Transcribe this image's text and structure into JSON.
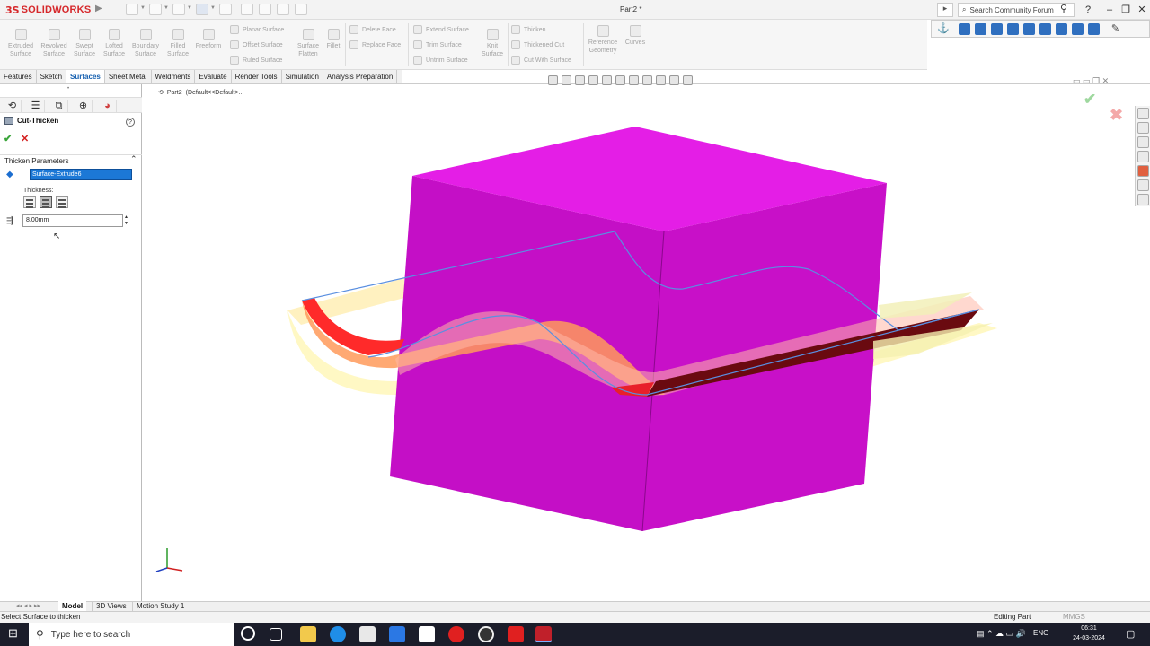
{
  "app": {
    "logo_ds": "3S",
    "logo_name": "SOLIDWORKS",
    "document_title": "Part2 *",
    "search_placeholder": "Search Community Forum"
  },
  "command_manager": {
    "big_tools": [
      {
        "line1": "Extruded",
        "line2": "Surface"
      },
      {
        "line1": "Revolved",
        "line2": "Surface"
      },
      {
        "line1": "Swept",
        "line2": "Surface"
      },
      {
        "line1": "Lofted",
        "line2": "Surface"
      },
      {
        "line1": "Boundary",
        "line2": "Surface"
      },
      {
        "line1": "Filled",
        "line2": "Surface"
      },
      {
        "line1": "Freeform",
        "line2": ""
      }
    ],
    "col1": [
      "Planar Surface",
      "Offset Surface",
      "Ruled Surface"
    ],
    "surface_flatten": {
      "line1": "Surface",
      "line2": "Flatten"
    },
    "fillet": "Fillet",
    "col2": [
      "Delete Face",
      "Replace Face"
    ],
    "col3": [
      "Extend Surface",
      "Trim Surface",
      "Untrim Surface"
    ],
    "knit": {
      "line1": "Knit",
      "line2": "Surface"
    },
    "col4": [
      "Thicken",
      "Thickened Cut",
      "Cut With Surface"
    ],
    "ref_geometry": {
      "line1": "Reference",
      "line2": "Geometry"
    },
    "curves": "Curves"
  },
  "tabs": [
    "Features",
    "Sketch",
    "Surfaces",
    "Sheet Metal",
    "Weldments",
    "Evaluate",
    "Render Tools",
    "Simulation",
    "Analysis Preparation"
  ],
  "active_tab": "Surfaces",
  "property_manager": {
    "title": "Cut-Thicken",
    "help": "?",
    "ok_glyph": "✔",
    "cancel_glyph": "✕",
    "section": "Thicken Parameters",
    "selected_surface": "Surface-Extrude6",
    "thickness_label": "Thickness:",
    "thickness_value": "8.00mm"
  },
  "feature_tree": {
    "part": "Part2",
    "config": "(Default<<Default>..."
  },
  "bottom_tabs": {
    "model": "Model",
    "views3d": "3D Views",
    "motion": "Motion Study 1"
  },
  "status": {
    "message": "Select Surface to thicken",
    "mode": "Editing Part",
    "units": "MMGS"
  },
  "taskbar": {
    "search": "Type here to search",
    "lang": "ENG",
    "time": "06:31",
    "date": "24-03-2024"
  },
  "colors": {
    "box": "#c80fc8",
    "box_top": "#dd22e0",
    "accent": "#1c78d6",
    "surface_red": "#e8202a"
  }
}
